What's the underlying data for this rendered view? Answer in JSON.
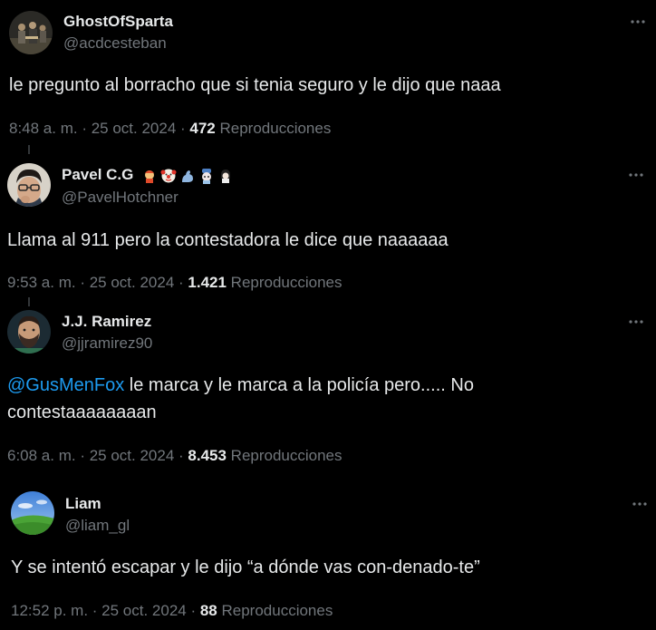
{
  "tweets": [
    {
      "name": "GhostOfSparta",
      "handle": "@acdcesteban",
      "text": "le pregunto al borracho que si tenia seguro y le dijo que naaa",
      "time": "8:48 a. m. · 25 oct. 2024 · ",
      "views": "472",
      "views_label": " Reproducciones",
      "avatar_icon": "band-photo-avatar"
    },
    {
      "name": "Pavel C.G",
      "handle": "@PavelHotchner",
      "text": "Llama al 911 pero la contestadora le dice que naaaaaa",
      "time": "9:53 a. m. · 25 oct. 2024 · ",
      "views": "1.421",
      "views_label": " Reproducciones",
      "emojis": [
        "fist-boy-emoji",
        "clown-emoji",
        "flexed-arm-emoji",
        "skull-hat-emoji",
        "ghost-girl-emoji"
      ],
      "avatar_icon": "man-with-glasses-avatar"
    },
    {
      "name": "J.J. Ramirez",
      "handle": "@jjramirez90",
      "mention": "@GusMenFox",
      "text_after_mention": " le marca y le marca a la policía pero..... No",
      "text_line2": "contestaaaaaaaan",
      "time": "6:08 a. m. · 25 oct. 2024 · ",
      "views": "8.453",
      "views_label": " Reproducciones",
      "avatar_icon": "bearded-man-avatar"
    },
    {
      "name": "Liam",
      "handle": "@liam_gl",
      "text": "Y se intentó escapar y le dijo “a dónde vas con-denado-te”",
      "time": "12:52 p. m. · 25 oct. 2024 · ",
      "views": "88",
      "views_label": " Reproducciones",
      "avatar_icon": "green-hill-sky-avatar"
    }
  ],
  "colors": {
    "background": "#000000",
    "primary_text": "#e7e9ea",
    "secondary_text": "#71767b",
    "mention": "#1d9bf0",
    "thread_line": "#333639"
  }
}
